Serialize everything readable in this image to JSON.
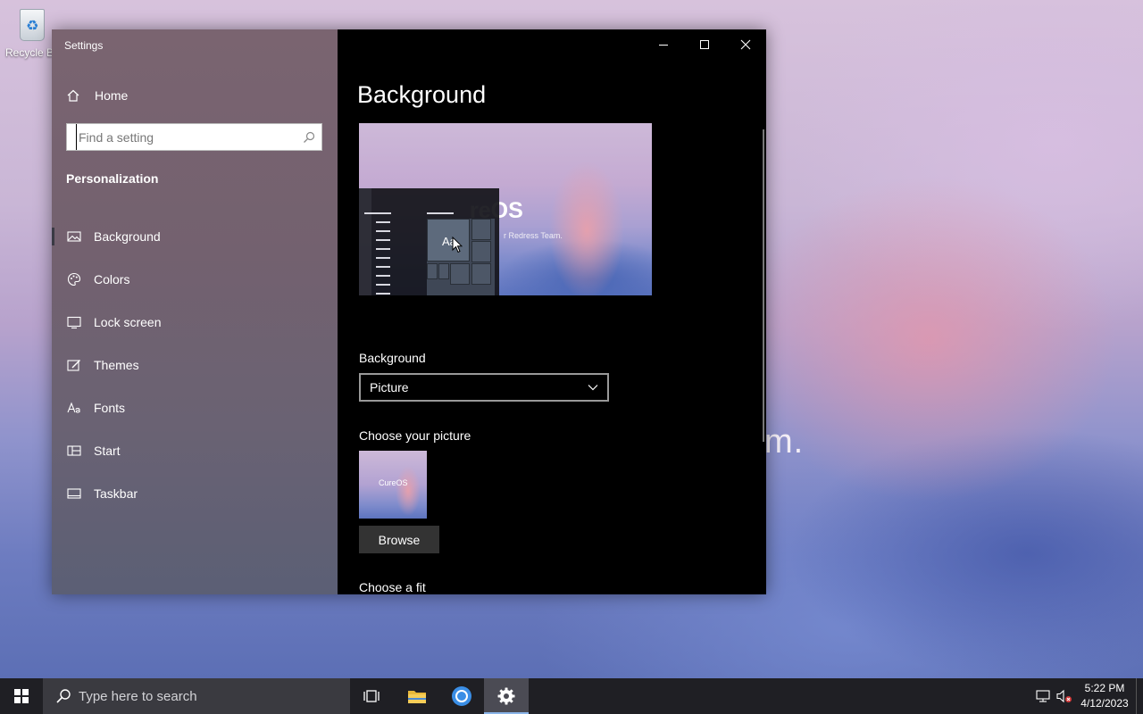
{
  "desktop": {
    "icons": [
      {
        "label": "Recycle Bin",
        "icon": "recycle-bin-icon"
      }
    ],
    "wallpaper_text": "m."
  },
  "window": {
    "title": "Settings",
    "controls": {
      "minimize": "minimize-icon",
      "maximize": "maximize-icon",
      "close": "close-icon"
    }
  },
  "sidebar": {
    "home_label": "Home",
    "search_placeholder": "Find a setting",
    "section_title": "Personalization",
    "items": [
      {
        "label": "Background",
        "icon": "image-icon",
        "active": true
      },
      {
        "label": "Colors",
        "icon": "palette-icon",
        "active": false
      },
      {
        "label": "Lock screen",
        "icon": "lock-screen-icon",
        "active": false
      },
      {
        "label": "Themes",
        "icon": "themes-icon",
        "active": false
      },
      {
        "label": "Fonts",
        "icon": "fonts-icon",
        "active": false
      },
      {
        "label": "Start",
        "icon": "start-icon",
        "active": false
      },
      {
        "label": "Taskbar",
        "icon": "taskbar-icon",
        "active": false
      }
    ]
  },
  "main": {
    "title": "Background",
    "preview": {
      "logo_text": "reOS",
      "sub_text": "r Redress Team.",
      "tile_text": "Aa"
    },
    "background_label": "Background",
    "background_value": "Picture",
    "choose_picture_label": "Choose your picture",
    "thumbnail_text": "CureOS",
    "browse_label": "Browse",
    "choose_fit_label": "Choose a fit"
  },
  "taskbar": {
    "search_placeholder": "Type here to search",
    "apps": [
      {
        "name": "task-view-icon",
        "active": false
      },
      {
        "name": "file-explorer-icon",
        "active": false
      },
      {
        "name": "chrome-icon",
        "active": false
      },
      {
        "name": "settings-gear-icon",
        "active": true
      }
    ],
    "tray": {
      "network": "network-icon",
      "volume": "volume-muted-icon"
    },
    "time": "5:22 PM",
    "date": "4/12/2023"
  },
  "colors": {
    "accent": "#8ab4e8",
    "sidebar": "#73616f",
    "content_bg": "#000000",
    "taskbar": "#1f1f24"
  }
}
